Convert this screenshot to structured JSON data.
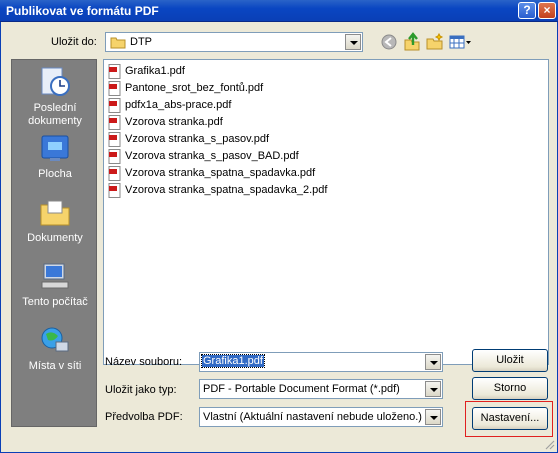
{
  "window": {
    "title": "Publikovat ve formátu PDF",
    "help_label": "?",
    "close_label": "×"
  },
  "lookin": {
    "label": "Uložit do:",
    "value": "DTP"
  },
  "toolbar": {
    "icons": [
      "back-icon",
      "up-folder-icon",
      "new-folder-icon",
      "view-menu-icon"
    ]
  },
  "places": [
    {
      "label": "Poslední dokumenty",
      "icon": "recent-documents-icon"
    },
    {
      "label": "Plocha",
      "icon": "desktop-icon"
    },
    {
      "label": "Dokumenty",
      "icon": "documents-folder-icon"
    },
    {
      "label": "Tento počítač",
      "icon": "my-computer-icon"
    },
    {
      "label": "Místa v síti",
      "icon": "network-places-icon"
    }
  ],
  "files": [
    "Grafika1.pdf",
    "Pantone_srot_bez_fontů.pdf",
    "pdfx1a_abs-prace.pdf",
    "Vzorova stranka.pdf",
    "Vzorova stranka_s_pasov.pdf",
    "Vzorova stranka_s_pasov_BAD.pdf",
    "Vzorova stranka_spatna_spadavka.pdf",
    "Vzorova stranka_spatna_spadavka_2.pdf"
  ],
  "form": {
    "filename_label": "Název souboru:",
    "filename_value": "Grafika1.pdf",
    "type_label": "Uložit jako typ:",
    "type_value": "PDF - Portable Document Format (*.pdf)",
    "preset_label": "Předvolba PDF:",
    "preset_value": "Vlastní (Aktuální nastavení nebude uloženo.)"
  },
  "buttons": {
    "save": "Uložit",
    "cancel": "Storno",
    "settings": "Nastavení..."
  },
  "colors": {
    "title_bar": "#0a46c2",
    "highlight": "#e02020",
    "selection": "#316ac5"
  }
}
